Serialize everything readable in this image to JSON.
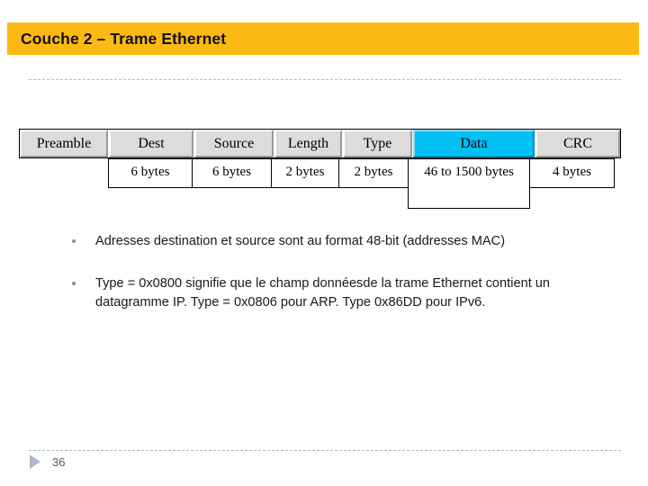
{
  "slide": {
    "title": "Couche 2 – Trame Ethernet",
    "accent_color": "#FDB913",
    "highlight_color": "#00BFF3"
  },
  "frame_diagram": {
    "fields": [
      {
        "name": "Preamble",
        "size": "",
        "highlighted": false
      },
      {
        "name": "Dest",
        "size": "6 bytes",
        "highlighted": false
      },
      {
        "name": "Source",
        "size": "6 bytes",
        "highlighted": false
      },
      {
        "name": "Length",
        "size": "2 bytes",
        "highlighted": false
      },
      {
        "name": "Type",
        "size": "2 bytes",
        "highlighted": false
      },
      {
        "name": "Data",
        "size": "46 to 1500 bytes",
        "highlighted": true
      },
      {
        "name": "CRC",
        "size": "4 bytes",
        "highlighted": false
      }
    ]
  },
  "bullets": [
    {
      "text": "Adresses destination et source sont au format 48-bit (addresses MAC)"
    },
    {
      "text": "Type = 0x0800 signifie que le champ donnéesde la trame Ethernet contient un datagramme IP.  Type = 0x0806 pour ARP. Type 0x86DD pour IPv6."
    }
  ],
  "footer": {
    "page_number": "36",
    "marker_icon": "triangle-right-icon"
  }
}
